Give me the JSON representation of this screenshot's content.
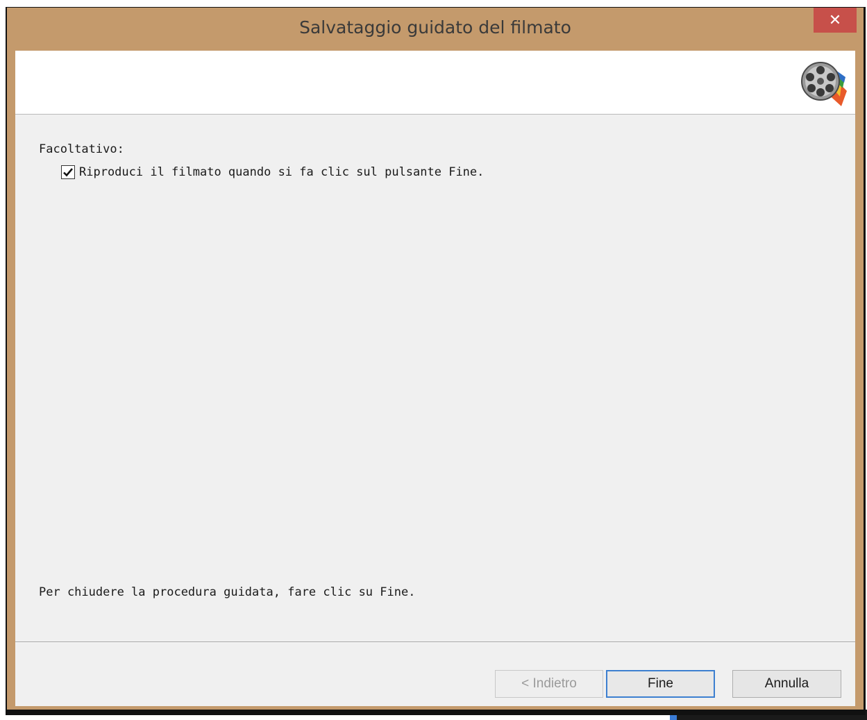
{
  "window": {
    "title": "Salvataggio guidato del filmato",
    "close_glyph": "✕"
  },
  "content": {
    "section_label": "Facoltativo:",
    "play_checkbox": {
      "label": "Riproduci il filmato quando si fa clic sul pulsante Fine.",
      "checked": true
    },
    "finish_hint": "Per chiudere la procedura guidata, fare clic su Fine."
  },
  "buttons": {
    "back": "< Indietro",
    "finish": "Fine",
    "cancel": "Annulla"
  },
  "icons": {
    "header": "movie-maker-film-reel-icon",
    "check": "checkmark-icon",
    "close": "close-icon"
  },
  "colors": {
    "titlebar": "#c49a6c",
    "close_button": "#c7504a",
    "client_bg": "#f0f0f0",
    "default_button_border": "#3c7fd0"
  }
}
